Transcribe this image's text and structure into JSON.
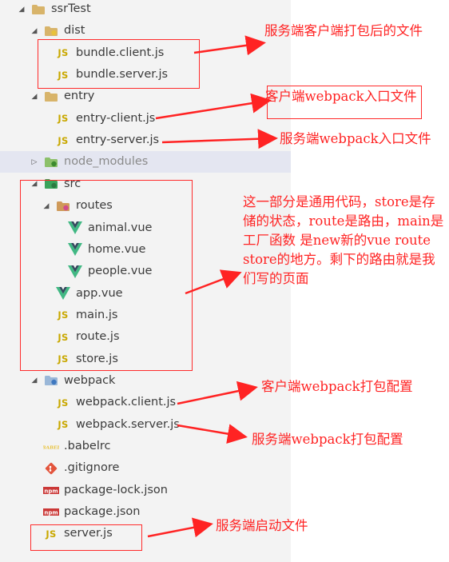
{
  "explorer": {
    "items": [
      {
        "label": "ssrTest",
        "depth": 0,
        "expanded": true,
        "icon": "folder-icon"
      },
      {
        "label": "dist",
        "depth": 1,
        "expanded": true,
        "icon": "folder-dist-icon"
      },
      {
        "label": "bundle.client.js",
        "depth": 2,
        "icon": "js-icon"
      },
      {
        "label": "bundle.server.js",
        "depth": 2,
        "icon": "js-icon"
      },
      {
        "label": "entry",
        "depth": 1,
        "expanded": true,
        "icon": "folder-icon"
      },
      {
        "label": "entry-client.js",
        "depth": 2,
        "icon": "js-icon"
      },
      {
        "label": "entry-server.js",
        "depth": 2,
        "icon": "js-icon"
      },
      {
        "label": "node_modules",
        "depth": 1,
        "expanded": false,
        "icon": "folder-node-icon",
        "selected": true
      },
      {
        "label": "src",
        "depth": 1,
        "expanded": true,
        "icon": "folder-src-icon"
      },
      {
        "label": "routes",
        "depth": 2,
        "expanded": true,
        "icon": "folder-routes-icon"
      },
      {
        "label": "animal.vue",
        "depth": 3,
        "icon": "vue-icon"
      },
      {
        "label": "home.vue",
        "depth": 3,
        "icon": "vue-icon"
      },
      {
        "label": "people.vue",
        "depth": 3,
        "icon": "vue-icon"
      },
      {
        "label": "app.vue",
        "depth": 2,
        "icon": "vue-icon"
      },
      {
        "label": "main.js",
        "depth": 2,
        "icon": "js-icon"
      },
      {
        "label": "route.js",
        "depth": 2,
        "icon": "js-icon"
      },
      {
        "label": "store.js",
        "depth": 2,
        "icon": "js-icon"
      },
      {
        "label": "webpack",
        "depth": 1,
        "expanded": true,
        "icon": "folder-webpack-icon"
      },
      {
        "label": "webpack.client.js",
        "depth": 2,
        "icon": "js-icon"
      },
      {
        "label": "webpack.server.js",
        "depth": 2,
        "icon": "js-icon"
      },
      {
        "label": ".babelrc",
        "depth": 1,
        "icon": "babel-icon"
      },
      {
        "label": ".gitignore",
        "depth": 1,
        "icon": "git-icon"
      },
      {
        "label": "package-lock.json",
        "depth": 1,
        "icon": "npm-icon"
      },
      {
        "label": "package.json",
        "depth": 1,
        "icon": "npm-icon"
      },
      {
        "label": "server.js",
        "depth": 1,
        "icon": "js-icon"
      }
    ]
  },
  "icon_text": {
    "js": "JS",
    "npm": "npm",
    "babel": "BABEL"
  },
  "annotations": {
    "dist_note": "服务端客户端打包后的文件",
    "entry_client_note": "客户端webpack入口文件",
    "entry_server_note": "服务端webpack入口文件",
    "src_note": "这一部分是通用代码，store是存储的状态，route是路由，main是工厂函数 是new新的vue route store的地方。剩下的路由就是我们写的页面",
    "webpack_client_note": "客户端webpack打包配置",
    "webpack_server_note": "服务端webpack打包配置",
    "server_note": "服务端启动文件"
  },
  "colors": {
    "annotation_red": "#ff2323",
    "js_yellow": "#c9a800",
    "vue_green": "#41b883",
    "vue_dark": "#35495e",
    "folder_tan": "#d8b46a",
    "sidebar_bg": "#f3f3f3",
    "selected_bg": "#e4e6f1"
  }
}
